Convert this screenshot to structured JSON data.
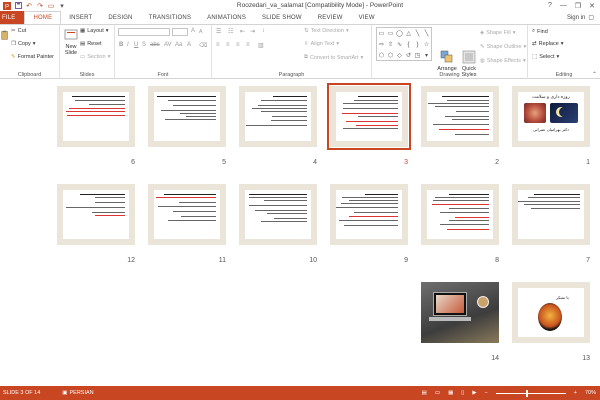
{
  "window": {
    "title": "Roozedari_va_salamat [Compatibility Mode] - PowerPoint",
    "controls": [
      "?",
      "—",
      "❐",
      "✕"
    ]
  },
  "tabs": [
    {
      "label": "FILE"
    },
    {
      "label": "HOME"
    },
    {
      "label": "INSERT"
    },
    {
      "label": "DESIGN"
    },
    {
      "label": "TRANSITIONS"
    },
    {
      "label": "ANIMATIONS"
    },
    {
      "label": "SLIDE SHOW"
    },
    {
      "label": "REVIEW"
    },
    {
      "label": "VIEW"
    }
  ],
  "signin": "Sign in",
  "ribbon": {
    "clipboard": {
      "cut": "Cut",
      "copy": "Copy",
      "format_painter": "Format Painter",
      "label": "Clipboard"
    },
    "slides": {
      "new_slide": "New Slide",
      "layout": "Layout",
      "reset": "Reset",
      "section": "Section",
      "label": "Slides"
    },
    "font": {
      "label": "Font"
    },
    "paragraph": {
      "text_direction": "Text Direction",
      "align_text": "Align Text",
      "convert_smartart": "Convert to SmartArt",
      "label": "Paragraph"
    },
    "drawing": {
      "arrange": "Arrange",
      "quick_styles": "Quick Styles",
      "shape_fill": "Shape Fill",
      "shape_outline": "Shape Outline",
      "shape_effects": "Shape Effects",
      "label": "Drawing"
    },
    "editing": {
      "find": "Find",
      "replace": "Replace",
      "select": "Select",
      "label": "Editing"
    }
  },
  "slides": [
    {
      "number": "1",
      "title_text": "روزه داری و سلامت",
      "author_text": "دکتر بهرامیان عمرانی"
    },
    {
      "number": "2"
    },
    {
      "number": "3"
    },
    {
      "number": "4"
    },
    {
      "number": "5"
    },
    {
      "number": "6"
    },
    {
      "number": "7"
    },
    {
      "number": "8"
    },
    {
      "number": "9"
    },
    {
      "number": "10"
    },
    {
      "number": "11"
    },
    {
      "number": "12"
    },
    {
      "number": "13",
      "text": "با تشکر"
    },
    {
      "number": "14"
    }
  ],
  "selected_slide": "3",
  "status": {
    "slide_info": "SLIDE 3 OF 14",
    "language": "PERSIAN",
    "zoom": "70%"
  },
  "colors": {
    "accent": "#c84622",
    "thumb_frame": "#ebe4d8"
  }
}
